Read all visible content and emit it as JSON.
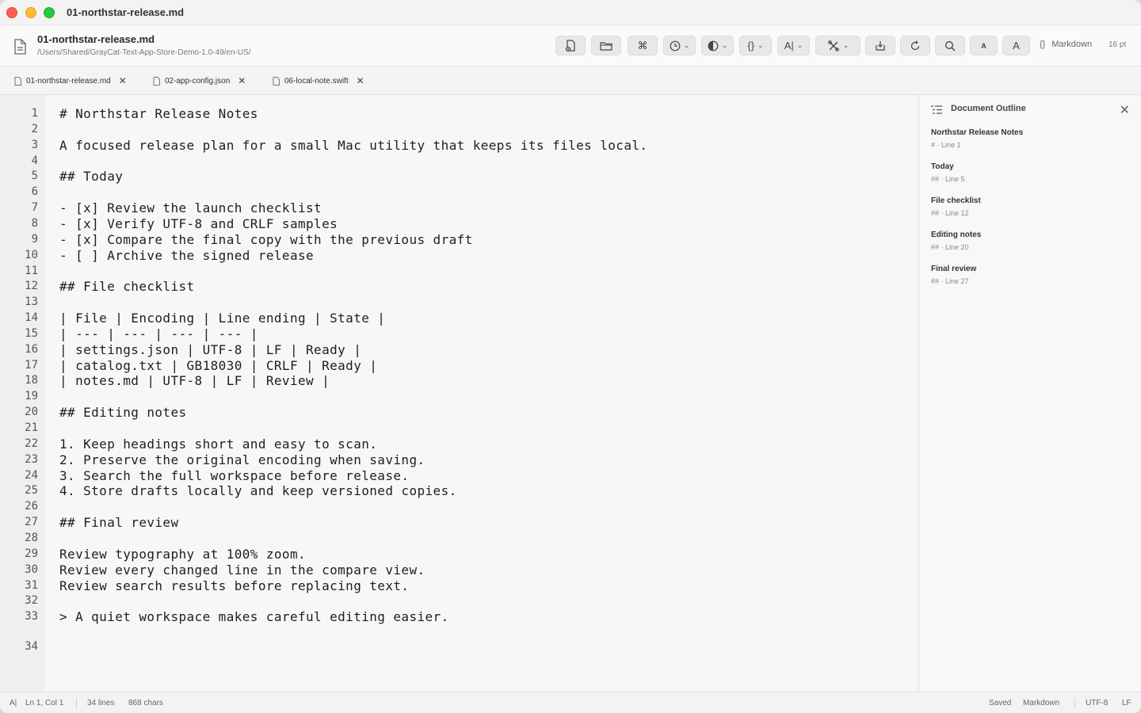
{
  "window": {
    "title": "01-northstar-release.md"
  },
  "header": {
    "doc_name": "01-northstar-release.md",
    "doc_path": "/Users/Shared/GrayCat-Text-App-Store-Demo-1.0-49/en-US/",
    "small_a": "A",
    "large_a": "A",
    "language": "Markdown",
    "language_icon": "{}",
    "font_size": "16 pt"
  },
  "tabs": [
    {
      "label": "01-northstar-release.md"
    },
    {
      "label": "02-app-config.json"
    },
    {
      "label": "06-local-note.swift"
    }
  ],
  "editor": {
    "lines": [
      "# Northstar Release Notes",
      "",
      "A focused release plan for a small Mac utility that keeps its files local.",
      "",
      "## Today",
      "",
      "- [x] Review the launch checklist",
      "- [x] Verify UTF-8 and CRLF samples",
      "- [x] Compare the final copy with the previous draft",
      "- [ ] Archive the signed release",
      "",
      "## File checklist",
      "",
      "| File | Encoding | Line ending | State |",
      "| --- | --- | --- | --- |",
      "| settings.json | UTF-8 | LF | Ready |",
      "| catalog.txt | GB18030 | CRLF | Ready |",
      "| notes.md | UTF-8 | LF | Review |",
      "",
      "## Editing notes",
      "",
      "1. Keep headings short and easy to scan.",
      "2. Preserve the original encoding when saving.",
      "3. Search the full workspace before release.",
      "4. Store drafts locally and keep versioned copies.",
      "",
      "## Final review",
      "",
      "Review typography at 100% zoom.",
      "Review every changed line in the compare view.",
      "Review search results before replacing text.",
      "",
      "> A quiet workspace makes careful editing easier.",
      ""
    ]
  },
  "outline": {
    "title": "Document Outline",
    "items": [
      {
        "name": "Northstar Release Notes",
        "meta": "# · Line 1"
      },
      {
        "name": "Today",
        "meta": "## · Line 5"
      },
      {
        "name": "File checklist",
        "meta": "## · Line 12"
      },
      {
        "name": "Editing notes",
        "meta": "## · Line 20"
      },
      {
        "name": "Final review",
        "meta": "## · Line 27"
      }
    ]
  },
  "status": {
    "cursor": "Ln 1, Col 1",
    "lines": "34 lines",
    "chars": "868 chars",
    "saved": "Saved",
    "language": "Markdown",
    "encoding": "UTF-8",
    "line_ending": "LF"
  }
}
